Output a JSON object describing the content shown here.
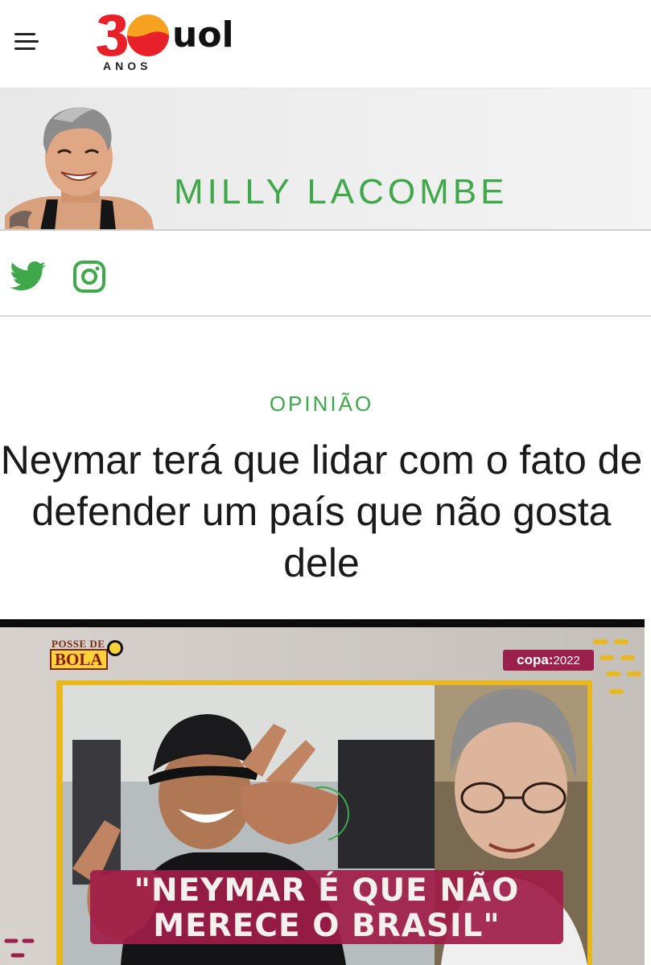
{
  "header": {
    "logo_number": "30",
    "logo_brand": "uol",
    "logo_sub": "ANOS",
    "menu_icon": "hamburger-menu-icon"
  },
  "author": {
    "name": "MILLY LACOMBE"
  },
  "social": {
    "items": [
      {
        "icon": "twitter-icon"
      },
      {
        "icon": "instagram-icon"
      }
    ],
    "color": "#3ea84a"
  },
  "article": {
    "kicker": "OPINIÃO",
    "headline": "Neymar terá que lidar com o fato de defender um país que não gosta dele"
  },
  "media": {
    "show_logo_top": "POSSE DE",
    "show_logo_bottom": "BOLA",
    "badge_brand": "copa",
    "badge_sep": ":",
    "badge_year": "2022",
    "quote_line1": "\"NEYMAR É QUE NÃO",
    "quote_line2": "MERECE O BRASIL\""
  },
  "colors": {
    "accent_green": "#3ea84a",
    "badge_magenta": "#9a1f4b",
    "frame_yellow": "#e8b81c"
  }
}
